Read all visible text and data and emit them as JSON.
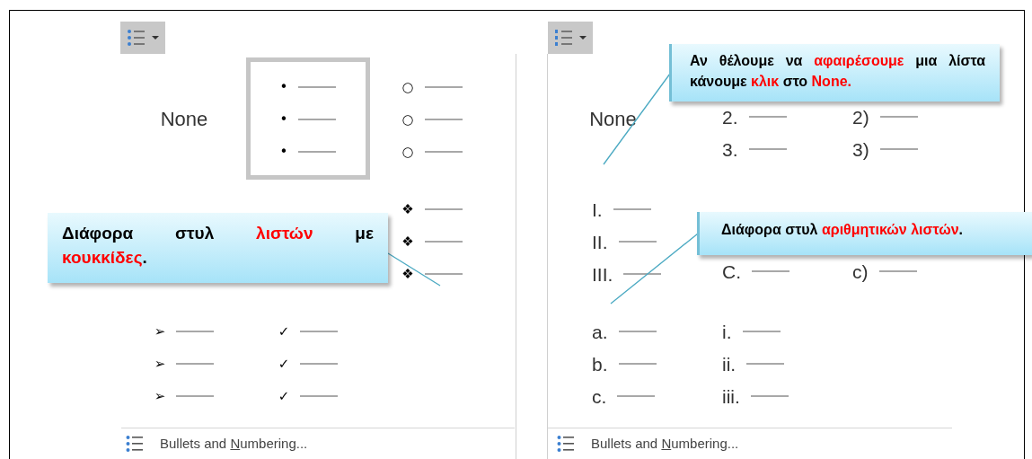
{
  "panels": [
    {
      "button": {
        "kind": "bullets"
      },
      "gallery": [
        {
          "kind": "none",
          "label": "None",
          "selected": false
        },
        {
          "kind": "bullets",
          "markers": [
            "•",
            "•",
            "•"
          ],
          "selected": true
        },
        {
          "kind": "bullets",
          "markers": [
            "○",
            "○",
            "○"
          ],
          "selected": false
        },
        {
          "kind": "bullets",
          "markers": [
            "❖",
            "❖",
            "❖"
          ],
          "selected": false
        },
        {
          "kind": "bullets",
          "markers": [
            "➢",
            "➢",
            "➢"
          ],
          "selected": false
        },
        {
          "kind": "bullets",
          "markers": [
            "✓",
            "✓",
            "✓"
          ],
          "selected": false
        }
      ],
      "footer": {
        "before": "Bullets and ",
        "key": "N",
        "after": "umbering..."
      }
    },
    {
      "button": {
        "kind": "numbering"
      },
      "gallery": [
        {
          "kind": "none",
          "label": "None",
          "selected": false
        },
        {
          "kind": "numbers",
          "markers": [
            "2.",
            "3."
          ],
          "selected": false
        },
        {
          "kind": "numbers",
          "markers": [
            "2)",
            "3)"
          ],
          "selected": false
        },
        {
          "kind": "numbers",
          "markers": [
            "I.",
            "II.",
            "III."
          ],
          "selected": false
        },
        {
          "kind": "numbers",
          "markers": [
            "C."
          ],
          "selected": false
        },
        {
          "kind": "numbers",
          "markers": [
            "c)"
          ],
          "selected": false
        },
        {
          "kind": "numbers",
          "markers": [
            "a.",
            "b.",
            "c."
          ],
          "selected": false
        },
        {
          "kind": "numbers",
          "markers": [
            "i.",
            "ii.",
            "iii."
          ],
          "selected": false
        }
      ],
      "footer": {
        "before": "Bullets and ",
        "key": "N",
        "after": "umbering..."
      }
    }
  ],
  "callouts": [
    {
      "segments": [
        {
          "text": "Διάφορα στυλ ",
          "highlight": false
        },
        {
          "text": "λιστών",
          "highlight": true
        },
        {
          "text": " με ",
          "highlight": false
        },
        {
          "text": "κουκκίδες",
          "highlight": true
        },
        {
          "text": ".",
          "highlight": false
        }
      ]
    },
    {
      "segments": [
        {
          "text": "Αν θέλουμε να ",
          "highlight": false
        },
        {
          "text": "αφαιρέσουμε",
          "highlight": true
        },
        {
          "text": " μια λίστα κάνουμε ",
          "highlight": false
        },
        {
          "text": "κλικ",
          "highlight": true
        },
        {
          "text": " στο ",
          "highlight": false
        },
        {
          "text": "None.",
          "highlight": true
        }
      ]
    },
    {
      "segments": [
        {
          "text": "Διάφορα στυλ ",
          "highlight": false
        },
        {
          "text": "αριθμητικών λιστών",
          "highlight": true
        },
        {
          "text": ".",
          "highlight": false
        }
      ]
    }
  ]
}
